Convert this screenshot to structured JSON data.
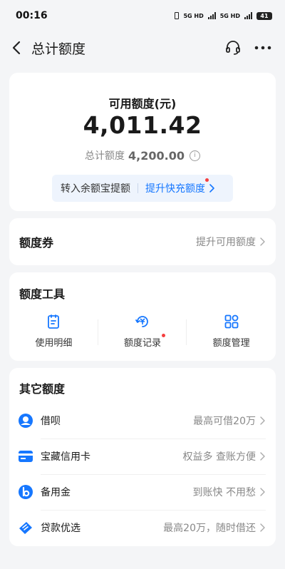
{
  "status_bar": {
    "time": "00:16",
    "net1": "5G HD",
    "net2": "5G HD",
    "battery": "41"
  },
  "nav": {
    "title": "总计额度"
  },
  "summary": {
    "available_label": "可用额度(元)",
    "available_amount": "4,011.42",
    "total_label": "总计额度",
    "total_amount": "4,200.00",
    "transfer_label": "转入余额宝提额",
    "boost_label": "提升快充额度"
  },
  "voucher": {
    "title": "额度券",
    "action": "提升可用额度"
  },
  "tools": {
    "title": "额度工具",
    "items": [
      {
        "label": "使用明细",
        "icon": "list-doc-icon"
      },
      {
        "label": "额度记录",
        "icon": "yuan-record-icon"
      },
      {
        "label": "额度管理",
        "icon": "grid-manage-icon"
      }
    ]
  },
  "other": {
    "title": "其它额度",
    "items": [
      {
        "name": "借呗",
        "desc": "最高可借20万",
        "icon": "jiebei-icon",
        "color": "#1677ff"
      },
      {
        "name": "宝藏信用卡",
        "desc": "权益多 查账方便",
        "icon": "credit-card-icon",
        "color": "#1677ff"
      },
      {
        "name": "备用金",
        "desc": "到账快 不用愁",
        "icon": "beiyongjin-icon",
        "color": "#1677ff"
      },
      {
        "name": "贷款优选",
        "desc": "最高20万，随时借还",
        "icon": "loan-ticket-icon",
        "color": "#1677ff"
      }
    ]
  },
  "colors": {
    "accent": "#1677ff",
    "badge": "#f53f3f",
    "background": "#f4f5f7"
  }
}
